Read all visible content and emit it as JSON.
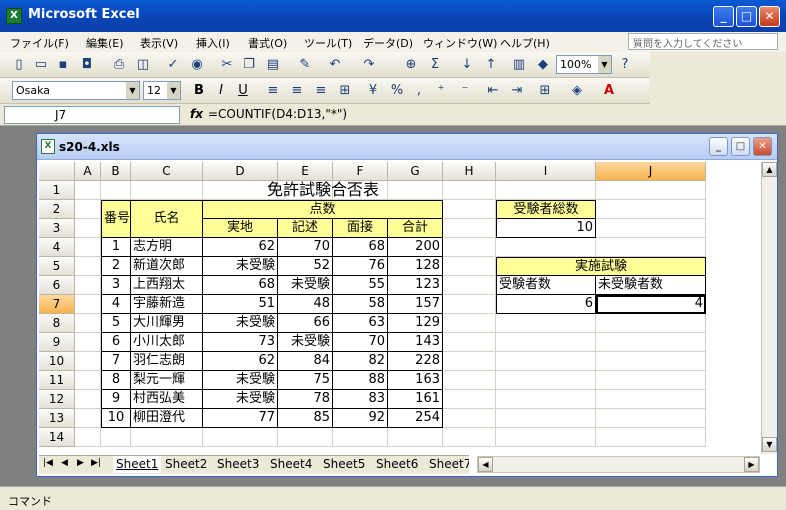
{
  "app": {
    "title": "Microsoft Excel",
    "icon": "X"
  },
  "menu": {
    "items": [
      "ファイル(F)",
      "編集(E)",
      "表示(V)",
      "挿入(I)",
      "書式(O)",
      "ツール(T)",
      "データ(D)",
      "ウィンドウ(W)",
      "ヘルプ(H)"
    ],
    "ask_placeholder": "質問を入力してください"
  },
  "toolbar": {
    "zoom": "100%",
    "font": "Osaka",
    "font_size": "12"
  },
  "formula_bar": {
    "cell_ref": "J7",
    "fx": "fx",
    "formula": "=COUNTIF(D4:D13,\"*\")"
  },
  "workbook": {
    "title": "s20-4.xls",
    "icon": "X"
  },
  "columns": [
    "A",
    "B",
    "C",
    "D",
    "E",
    "F",
    "G",
    "H",
    "I",
    "J"
  ],
  "rows": [
    "1",
    "2",
    "3",
    "4",
    "5",
    "6",
    "7",
    "8",
    "9",
    "10",
    "11",
    "12",
    "13",
    "14"
  ],
  "sheet": {
    "title": "免許試験合否表",
    "h_number": "番号",
    "h_name": "氏名",
    "h_points": "点数",
    "h_practical": "実地",
    "h_written": "記述",
    "h_interview": "面接",
    "h_total": "合計",
    "records": [
      {
        "no": "1",
        "name": "志方明",
        "jitchi": "62",
        "kijutsu": "70",
        "mensetsu": "68",
        "total": "200"
      },
      {
        "no": "2",
        "name": "新道次郎",
        "jitchi": "未受験",
        "kijutsu": "52",
        "mensetsu": "76",
        "total": "128"
      },
      {
        "no": "3",
        "name": "上西翔太",
        "jitchi": "68",
        "kijutsu": "未受験",
        "mensetsu": "55",
        "total": "123"
      },
      {
        "no": "4",
        "name": "宇藤新造",
        "jitchi": "51",
        "kijutsu": "48",
        "mensetsu": "58",
        "total": "157"
      },
      {
        "no": "5",
        "name": "大川輝男",
        "jitchi": "未受験",
        "kijutsu": "66",
        "mensetsu": "63",
        "total": "129"
      },
      {
        "no": "6",
        "name": "小川太郎",
        "jitchi": "73",
        "kijutsu": "未受験",
        "mensetsu": "70",
        "total": "143"
      },
      {
        "no": "7",
        "name": "羽仁志朗",
        "jitchi": "62",
        "kijutsu": "84",
        "mensetsu": "82",
        "total": "228"
      },
      {
        "no": "8",
        "name": "梨元一輝",
        "jitchi": "未受験",
        "kijutsu": "75",
        "mensetsu": "88",
        "total": "163"
      },
      {
        "no": "9",
        "name": "村西弘美",
        "jitchi": "未受験",
        "kijutsu": "78",
        "mensetsu": "83",
        "total": "161"
      },
      {
        "no": "10",
        "name": "柳田澄代",
        "jitchi": "77",
        "kijutsu": "85",
        "mensetsu": "92",
        "total": "254"
      }
    ],
    "total_examinees_label": "受験者総数",
    "total_examinees": "10",
    "practical_label": "実施試験",
    "taken_label": "受験者数",
    "not_taken_label": "未受験者数",
    "taken": "6",
    "not_taken": "4"
  },
  "tabs": [
    "Sheet1",
    "Sheet2",
    "Sheet3",
    "Sheet4",
    "Sheet5",
    "Sheet6",
    "Sheet7"
  ],
  "status": "コマンド",
  "colors": {
    "header_fill": "#ffff99",
    "selected_header": "#f7b24c",
    "title_bar": "#0a5ad4"
  }
}
